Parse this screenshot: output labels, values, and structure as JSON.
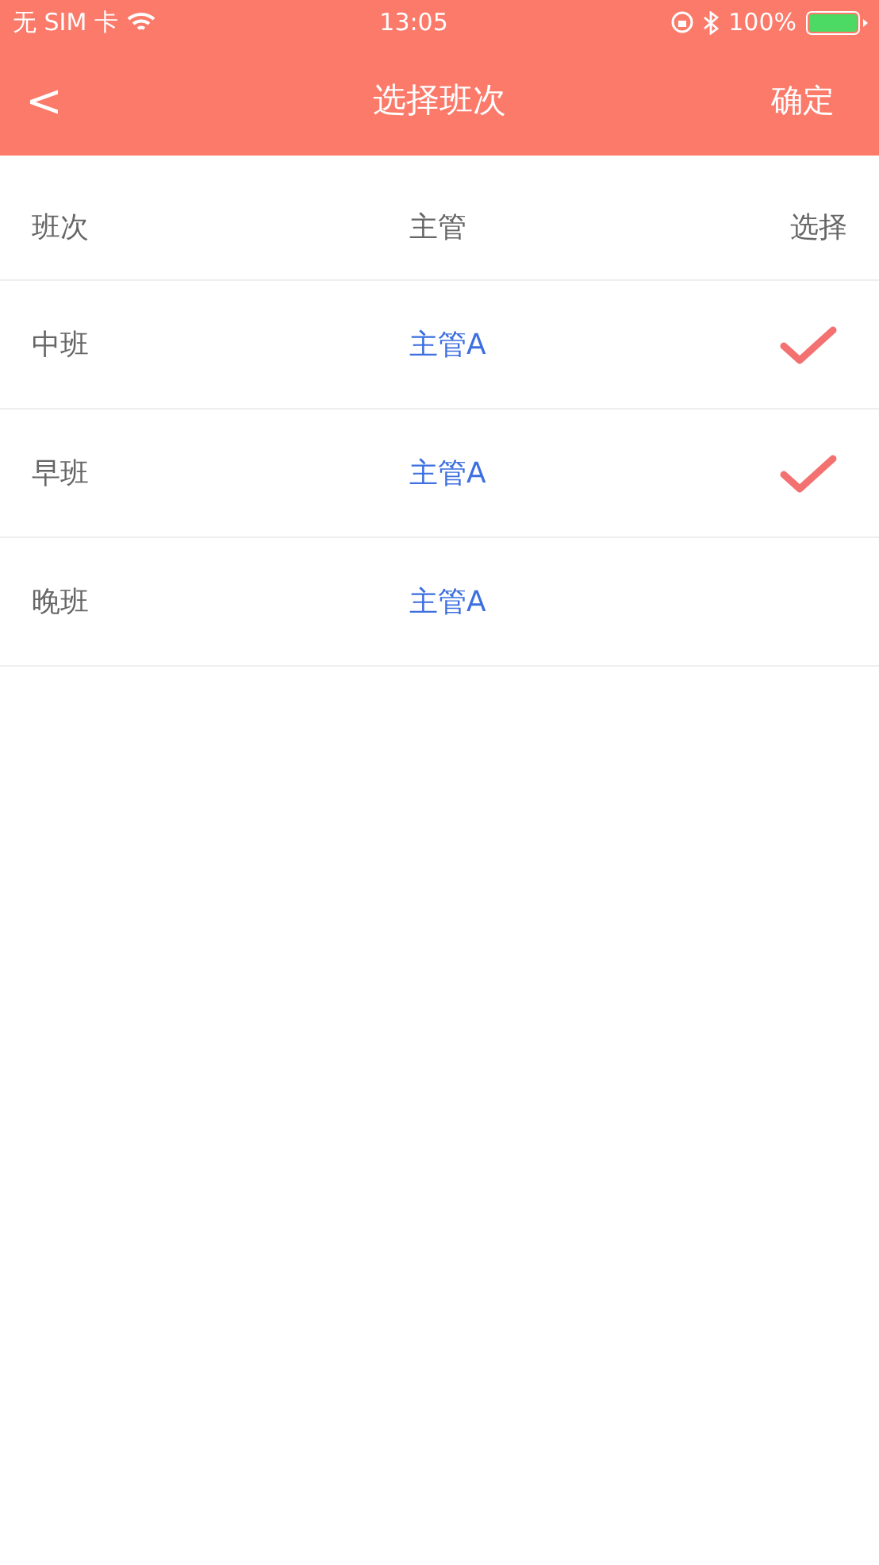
{
  "status_bar": {
    "carrier": "无 SIM 卡",
    "time": "13:05",
    "battery": "100%"
  },
  "nav": {
    "back": "<",
    "title": "选择班次",
    "action": "确定"
  },
  "table": {
    "columns": [
      "班次",
      "主管",
      "选择"
    ],
    "rows": [
      {
        "shift": "中班",
        "manager": "主管A",
        "selected": true
      },
      {
        "shift": "早班",
        "manager": "主管A",
        "selected": true
      },
      {
        "shift": "晚班",
        "manager": "主管A",
        "selected": false
      }
    ]
  }
}
